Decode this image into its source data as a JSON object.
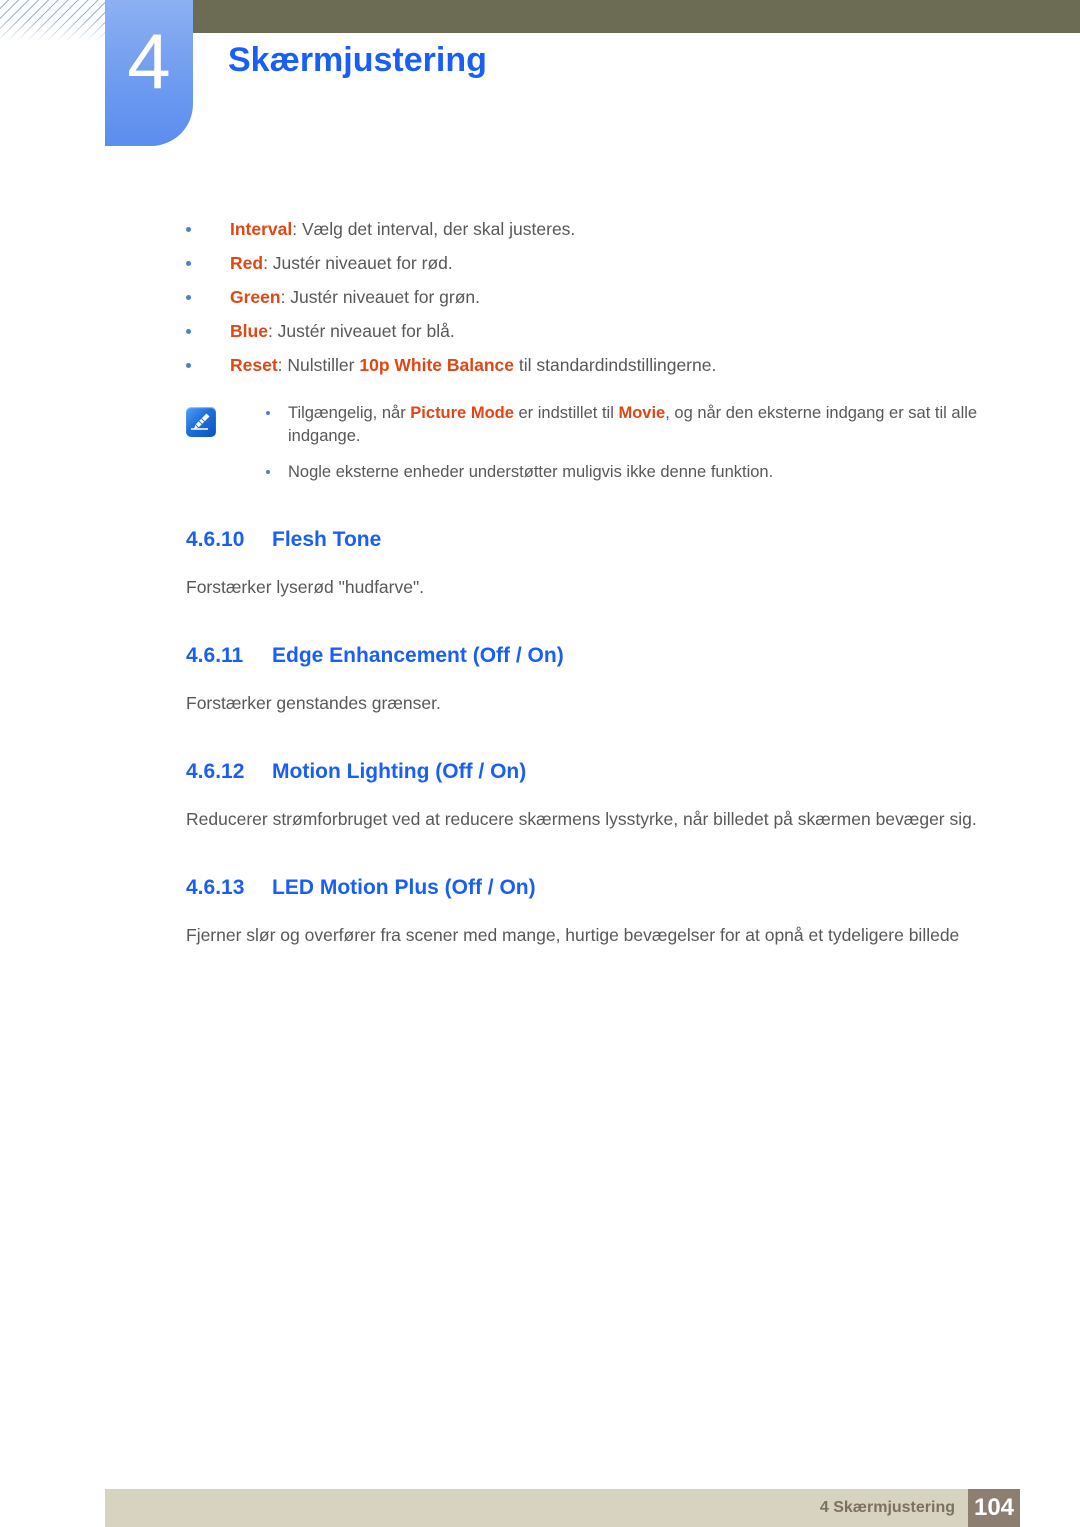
{
  "header": {
    "chapter_number": "4",
    "chapter_title": "Skærmjustering",
    "accent_blue": "#1a5ff5",
    "olive_bar_color": "#6c6b53",
    "tab_blue": "#6f9cf0"
  },
  "bullet_list": [
    {
      "keyword": "Interval",
      "rest": ": Vælg det interval, der skal justeres."
    },
    {
      "keyword": "Red",
      "rest": ": Justér niveauet for rød."
    },
    {
      "keyword": "Green",
      "rest": ": Justér niveauet for grøn."
    },
    {
      "keyword": "Blue",
      "rest": ": Justér niveauet for blå."
    },
    {
      "keyword": "Reset",
      "rest_a": ": Nulstiller ",
      "keyword_b": "10p White Balance",
      "rest_b": " til standardindstillingerne."
    }
  ],
  "note": {
    "icon": "note-pen-icon",
    "line1_a": "Tilgængelig, når ",
    "line1_kw1": "Picture Mode",
    "line1_b": " er indstillet til ",
    "line1_kw2": "Movie",
    "line1_c": ", og når den eksterne indgang er sat til alle indgange.",
    "line2": "Nogle eksterne enheder understøtter muligvis ikke denne funktion."
  },
  "sections": [
    {
      "number": "4.6.10",
      "title": "Flesh Tone",
      "body": "Forstærker lyserød \"hudfarve\"."
    },
    {
      "number": "4.6.11",
      "title": "Edge Enhancement (Off / On)",
      "body": "Forstærker genstandes grænser."
    },
    {
      "number": "4.6.12",
      "title": "Motion Lighting (Off / On)",
      "body": "Reducerer strømforbruget ved at reducere skærmens lysstyrke, når billedet på skærmen bevæger sig."
    },
    {
      "number": "4.6.13",
      "title": "LED Motion Plus (Off / On)",
      "body": "Fjerner slør og overfører fra scener med mange, hurtige bevægelser for at opnå et tydeligere billede"
    }
  ],
  "footer": {
    "text": "4 Skærmjustering",
    "page_number": "104",
    "bar_color": "#d8d3c0",
    "page_box_color": "#8c7f72"
  },
  "colors": {
    "keyword_orange": "#df4814",
    "body_gray": "#58585a",
    "bullet_blue": "#4a7fd4"
  }
}
